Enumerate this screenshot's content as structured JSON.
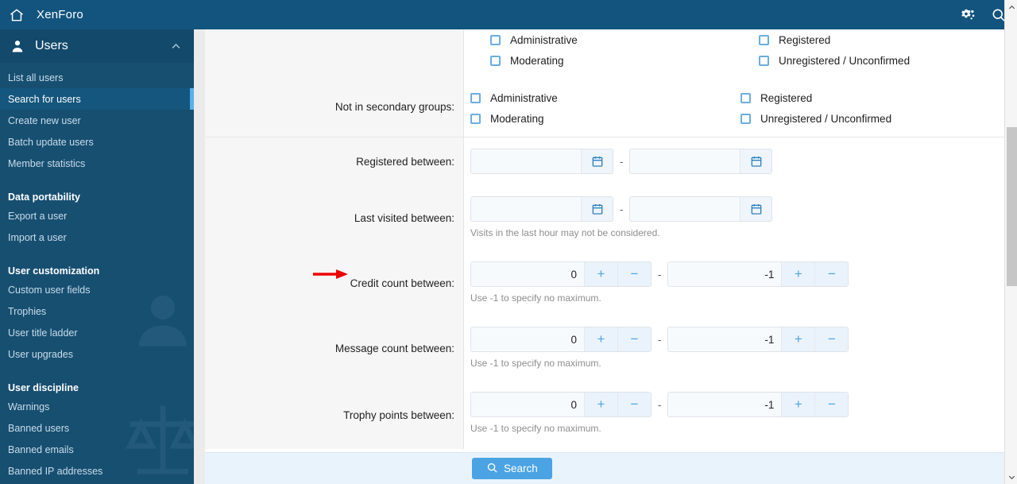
{
  "topbar": {
    "home_icon": "home-icon",
    "brand": "XenForo",
    "settings_icon": "gears-icon",
    "search_icon": "search-icon"
  },
  "sidebar": {
    "section_title": "Users",
    "user_icon": "user-icon",
    "collapse_icon": "chevron-up-icon",
    "groups": [
      {
        "heading": null,
        "items": [
          {
            "label": "List all users",
            "active": false
          },
          {
            "label": "Search for users",
            "active": true
          },
          {
            "label": "Create new user",
            "active": false
          },
          {
            "label": "Batch update users",
            "active": false
          },
          {
            "label": "Member statistics",
            "active": false
          }
        ]
      },
      {
        "heading": "Data portability",
        "items": [
          {
            "label": "Export a user",
            "active": false
          },
          {
            "label": "Import a user",
            "active": false
          }
        ]
      },
      {
        "heading": "User customization",
        "items": [
          {
            "label": "Custom user fields",
            "active": false
          },
          {
            "label": "Trophies",
            "active": false
          },
          {
            "label": "User title ladder",
            "active": false
          },
          {
            "label": "User upgrades",
            "active": false
          }
        ]
      },
      {
        "heading": "User discipline",
        "items": [
          {
            "label": "Warnings",
            "active": false
          },
          {
            "label": "Banned users",
            "active": false
          },
          {
            "label": "Banned emails",
            "active": false
          },
          {
            "label": "Banned IP addresses",
            "active": false
          }
        ]
      }
    ]
  },
  "form": {
    "rows": [
      {
        "type": "checkboxes-partial",
        "label": "",
        "columns": [
          {
            "options": [
              "Administrative",
              "Moderating"
            ]
          },
          {
            "options": [
              "Registered",
              "Unregistered / Unconfirmed"
            ]
          }
        ]
      },
      {
        "type": "checkboxes",
        "label": "Not in secondary groups:",
        "columns": [
          {
            "options": [
              "Administrative",
              "Moderating"
            ]
          },
          {
            "options": [
              "Registered",
              "Unregistered / Unconfirmed"
            ]
          }
        ]
      },
      {
        "type": "daterange",
        "label": "Registered between:",
        "from_value": "",
        "to_value": "",
        "separator": "-",
        "calendar_icon": "calendar-icon",
        "hint": ""
      },
      {
        "type": "daterange",
        "label": "Last visited between:",
        "from_value": "",
        "to_value": "",
        "separator": "-",
        "calendar_icon": "calendar-icon",
        "hint": "Visits in the last hour may not be considered."
      },
      {
        "type": "numberrange",
        "label": "Credit count between:",
        "from_value": "0",
        "to_value": "-1",
        "separator": "-",
        "plus": "+",
        "minus": "−",
        "hint": "Use -1 to specify no maximum.",
        "annotated": true
      },
      {
        "type": "numberrange",
        "label": "Message count between:",
        "from_value": "0",
        "to_value": "-1",
        "separator": "-",
        "plus": "+",
        "minus": "−",
        "hint": "Use -1 to specify no maximum.",
        "annotated": false
      },
      {
        "type": "numberrange",
        "label": "Trophy points between:",
        "from_value": "0",
        "to_value": "-1",
        "separator": "-",
        "plus": "+",
        "minus": "−",
        "hint": "Use -1 to specify no maximum.",
        "annotated": false
      }
    ]
  },
  "footer": {
    "search_label": "Search",
    "search_icon": "search-icon"
  },
  "annotation": {
    "arrow_color": "#ee0000",
    "points_to": "Credit count between:"
  },
  "colors": {
    "topbar": "#12547e",
    "sidebar": "#174f71",
    "accent": "#4ba3e3",
    "active_indicator": "#5bb0ea",
    "label_bg": "#f6f6f6",
    "footer_bg": "#e9f3fb"
  },
  "scrollbar": {
    "up_icon": "chevron-up-icon",
    "down_icon": "chevron-down-icon"
  }
}
